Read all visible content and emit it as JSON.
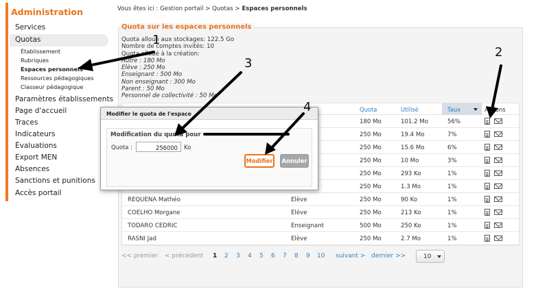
{
  "sidebar": {
    "title": "Administration",
    "items": [
      {
        "label": "Services"
      },
      {
        "label": "Quotas"
      },
      {
        "label": "Paramètres établissements"
      },
      {
        "label": "Page d'accueil"
      },
      {
        "label": "Traces"
      },
      {
        "label": "Indicateurs"
      },
      {
        "label": "Évaluations"
      },
      {
        "label": "Export MEN"
      },
      {
        "label": "Absences"
      },
      {
        "label": "Sanctions et punitions"
      },
      {
        "label": "Accès portail"
      }
    ],
    "subitems": [
      {
        "label": "Établissement"
      },
      {
        "label": "Rubriques"
      },
      {
        "label": "Espaces personnels"
      },
      {
        "label": "Ressources pédagogiques"
      },
      {
        "label": "Classeur pédagogique"
      }
    ]
  },
  "breadcrumb": {
    "prefix": "Vous êtes ici : Gestion portail > Quotas > ",
    "current": "Espaces personnels"
  },
  "section": {
    "title": "Quota sur les espaces personnels",
    "info_lines": [
      "Quota alloué aux stockages: 122.5 Go",
      "Nombre de comptes invités: 10",
      "Quota alloué à la création:"
    ],
    "alloc_lines": [
      "Autre : 180 Mo",
      "Elève : 250 Mo",
      "Enseignant : 500 Mo",
      "Non enseignant : 300 Mo",
      "Parent : 50 Mo",
      "Personnel de collectivité : 50 Mo"
    ]
  },
  "table": {
    "headers": {
      "quota": "Quota",
      "used": "Utilisé",
      "rate": "Taux",
      "actions": "Actions"
    },
    "rows": [
      {
        "name": "",
        "profile": "",
        "quota": "180 Mo",
        "used": "101.2 Mo",
        "rate": "56%"
      },
      {
        "name": "",
        "profile": "",
        "quota": "250 Mo",
        "used": "19.4 Mo",
        "rate": "7%"
      },
      {
        "name": "",
        "profile": "",
        "quota": "250 Mo",
        "used": "15.6 Mo",
        "rate": "6%"
      },
      {
        "name": "",
        "profile": "",
        "quota": "250 Mo",
        "used": "10 Mo",
        "rate": "3%"
      },
      {
        "name": "",
        "profile": "",
        "quota": "250 Mo",
        "used": "293 Ko",
        "rate": "1%"
      },
      {
        "name": "",
        "profile": "",
        "quota": "250 Mo",
        "used": "1.3 Mo",
        "rate": "1%"
      },
      {
        "name": "REQUENA Mathéo",
        "profile": "Elève",
        "quota": "250 Mo",
        "used": "90 Ko",
        "rate": "1%"
      },
      {
        "name": "COELHO Morgane",
        "profile": "Elève",
        "quota": "250 Mo",
        "used": "213 Ko",
        "rate": "1%"
      },
      {
        "name": "TODARO CEDRIC",
        "profile": "Enseignant",
        "quota": "500 Mo",
        "used": "250 Ko",
        "rate": "1%"
      },
      {
        "name": "RASNI Jad",
        "profile": "Elève",
        "quota": "250 Mo",
        "used": "2.7 Mo",
        "rate": "1%"
      }
    ]
  },
  "pager": {
    "first": "<< premier",
    "prev": "< précédent",
    "pages": [
      "1",
      "2",
      "3",
      "4",
      "5",
      "6",
      "7",
      "8",
      "9",
      "10"
    ],
    "current": "1",
    "next": "suivant >",
    "last": "dernier >>",
    "page_size": "10"
  },
  "modal": {
    "title": "Modifier le quota de l'espace",
    "legend": "Modification du quota pour",
    "quota_label": "Quota :",
    "quota_value": "256000",
    "unit": "Ko",
    "ok_label": "Modifier",
    "cancel_label": "Annuler"
  },
  "annotations": {
    "markers": [
      "1",
      "2",
      "3",
      "4"
    ]
  },
  "colors": {
    "accent": "#e8731d",
    "link": "#2f7fc1"
  }
}
